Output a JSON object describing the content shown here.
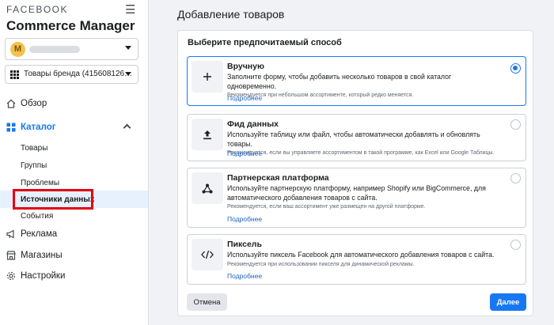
{
  "sidebar": {
    "brand": "FACEBOOK",
    "app_title": "Commerce Manager",
    "account": {
      "avatar_letter": "M"
    },
    "catalog_select": "Товары бренда (415608126…",
    "nav": {
      "overview": "Обзор",
      "catalog": "Каталог",
      "ads": "Реклама",
      "shops": "Магазины",
      "settings": "Настройки"
    },
    "catalog_sub": {
      "products": "Товары",
      "groups": "Группы",
      "problems": "Проблемы",
      "data_sources": "Источники данных",
      "events": "События"
    }
  },
  "main": {
    "page_title": "Добавление товаров",
    "card_heading": "Выберите предпочитаемый способ",
    "options": [
      {
        "title": "Вручную",
        "desc": "Заполните форму, чтобы добавить несколько товаров в свой каталог одновременно.",
        "rec": "Рекомендуется при небольшом ассортименте, который редко меняется.",
        "link": "Подробнее",
        "icon": "plus-icon",
        "selected": true
      },
      {
        "title": "Фид данных",
        "desc": "Используйте таблицу или файл, чтобы автоматически добавлять и обновлять товары.",
        "rec": "Рекомендуется, если вы управляете ассортиментом в такой программе, как Excel или Google Таблицы.",
        "link": "Подробнее",
        "icon": "upload-icon",
        "selected": false
      },
      {
        "title": "Партнерская платформа",
        "desc": "Используйте партнерскую платформу, например Shopify или BigCommerce, для автоматического добавления товаров с сайта.",
        "rec": "Рекомендуется, если ваш ассортимент уже размещен на другой платформе.",
        "link": "Подробнее",
        "icon": "network-icon",
        "selected": false
      },
      {
        "title": "Пиксель",
        "desc": "Используйте пиксель Facebook для автоматического добавления товаров с сайта.",
        "rec": "Рекомендуется при использовании пикселя для динамической рекламы.",
        "link": "Подробнее",
        "icon": "code-icon",
        "selected": false
      }
    ],
    "cancel_label": "Отмена",
    "next_label": "Далее"
  },
  "colors": {
    "accent": "#1877f2",
    "highlight": "#e7f0fd",
    "annotation": "#e4000f"
  }
}
